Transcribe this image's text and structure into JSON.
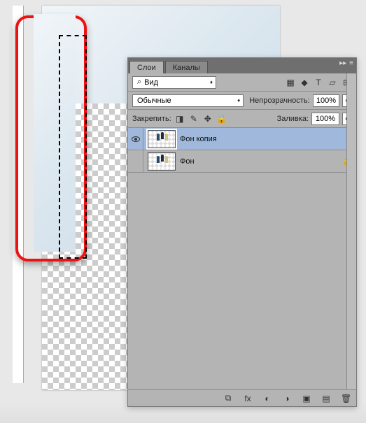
{
  "tabs": {
    "layers": "Слои",
    "channels": "Каналы"
  },
  "filter": {
    "prefix": "Вид"
  },
  "blend": {
    "mode": "Обычные",
    "opacity_label": "Непрозрачность:",
    "opacity": "100%"
  },
  "lock": {
    "label": "Закрепить:",
    "fill_label": "Заливка:",
    "fill": "100%"
  },
  "layers": [
    {
      "name": "Фон копия",
      "visible": true,
      "locked": false,
      "selected": true
    },
    {
      "name": "Фон",
      "visible": false,
      "locked": true,
      "selected": false
    }
  ],
  "icons": {
    "search": "⌕",
    "eye": "",
    "img": "▦",
    "fx_top": "◆",
    "text": "T",
    "shape": "▱",
    "filter": "⊞",
    "squares": "◨",
    "brush": "✎",
    "move": "✥",
    "lock": "🔒",
    "link": "⧉",
    "fx": "fx",
    "mask": "◐",
    "adjust": "◑",
    "folder": "▣",
    "new": "▤",
    "trash": "🗑",
    "expand": "▸▸",
    "menu": "≡",
    "dd": "▾",
    "dd2": "▸"
  }
}
